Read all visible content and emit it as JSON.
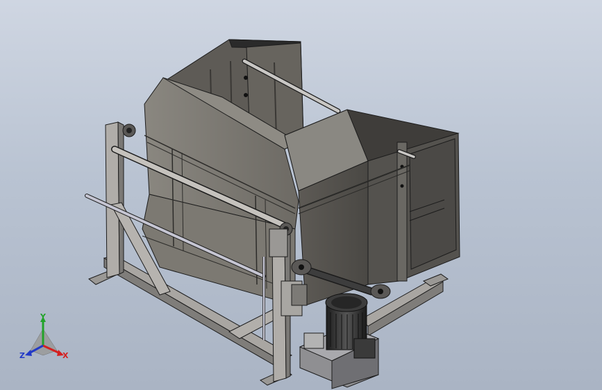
{
  "viewport": {
    "background_top": "#cfd6e2",
    "background_bottom": "#aab4c4"
  },
  "model": {
    "hopper_color": "#77746d",
    "hopper_dark": "#4f4c47",
    "frame_color": "#a9a6a2",
    "frame_dark": "#6f6d6a",
    "edge_color": "#1c1c1c",
    "motor_color": "#2e2e2e"
  },
  "triad": {
    "x_label": "X",
    "y_label": "Y",
    "z_label": "Z",
    "x_color": "#d42020",
    "y_color": "#22a32a",
    "z_color": "#2239c7"
  }
}
